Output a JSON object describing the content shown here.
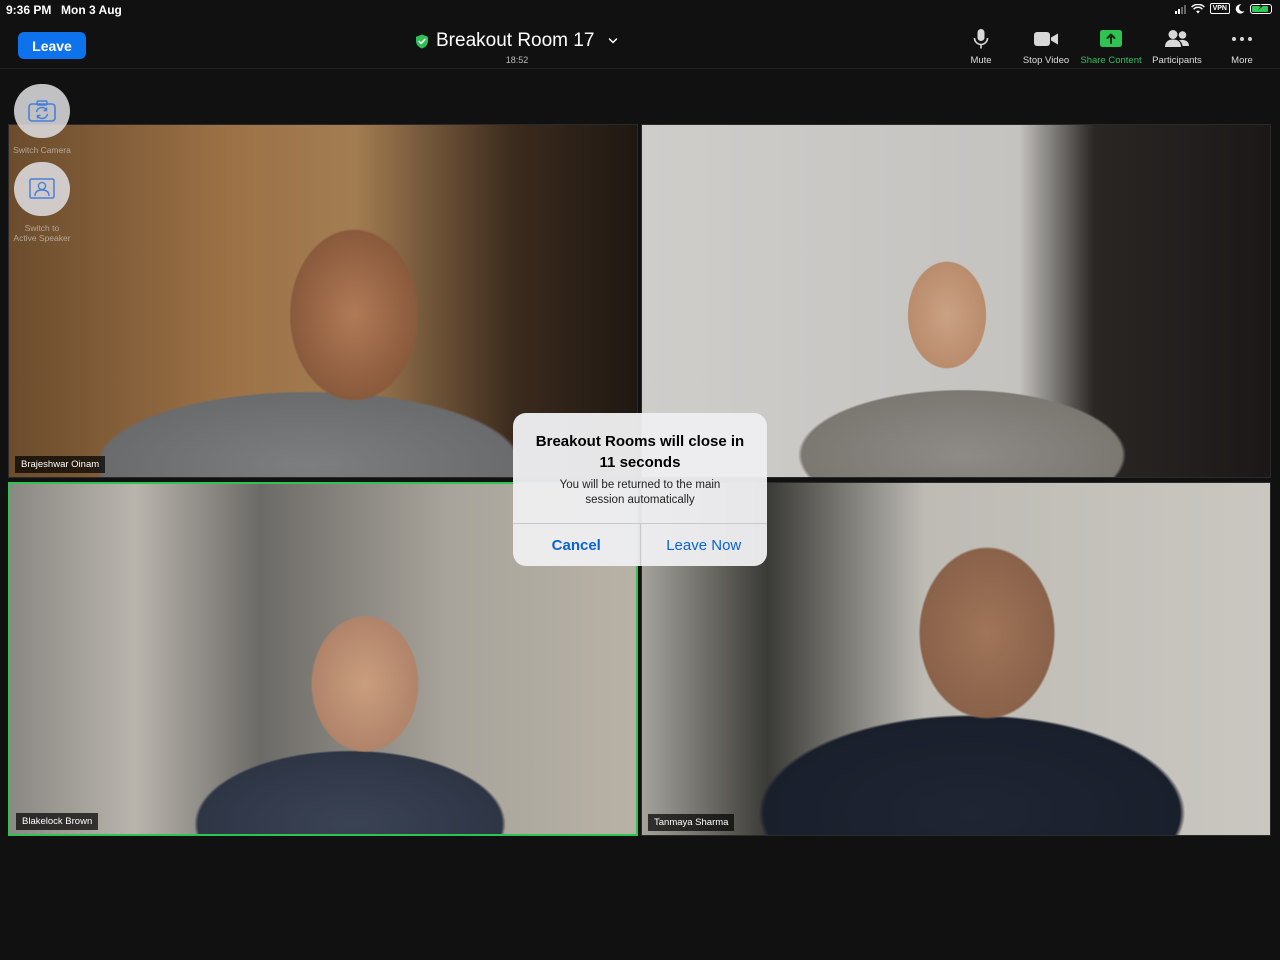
{
  "status_bar": {
    "time": "9:36 PM",
    "date": "Mon 3 Aug",
    "vpn": "VPN"
  },
  "toolbar": {
    "leave_label": "Leave",
    "room_title": "Breakout Room 17",
    "timer": "18:52",
    "tools": [
      {
        "label": "Mute",
        "icon": "microphone-icon"
      },
      {
        "label": "Stop Video",
        "icon": "video-camera-icon"
      },
      {
        "label": "Share Content",
        "icon": "share-screen-icon"
      },
      {
        "label": "Participants",
        "icon": "participants-icon"
      },
      {
        "label": "More",
        "icon": "more-dots-icon"
      }
    ],
    "accent_color": "#0e72ed",
    "share_color": "#33c05a"
  },
  "side_controls": {
    "switch_camera": "Switch Camera",
    "switch_speaker_line1": "Switch to",
    "switch_speaker_line2": "Active Speaker"
  },
  "participants": [
    {
      "name": "Brajeshwar Oinam",
      "active_speaker": false
    },
    {
      "name": "",
      "active_speaker": false
    },
    {
      "name": "Blakelock Brown",
      "active_speaker": true
    },
    {
      "name": "Tanmaya Sharma",
      "active_speaker": false
    }
  ],
  "alert": {
    "title_line1": "Breakout Rooms will close in",
    "title_line2": "11 seconds",
    "message_line1": "You will be returned to the main",
    "message_line2": "session automatically",
    "cancel_label": "Cancel",
    "leave_now_label": "Leave Now"
  }
}
